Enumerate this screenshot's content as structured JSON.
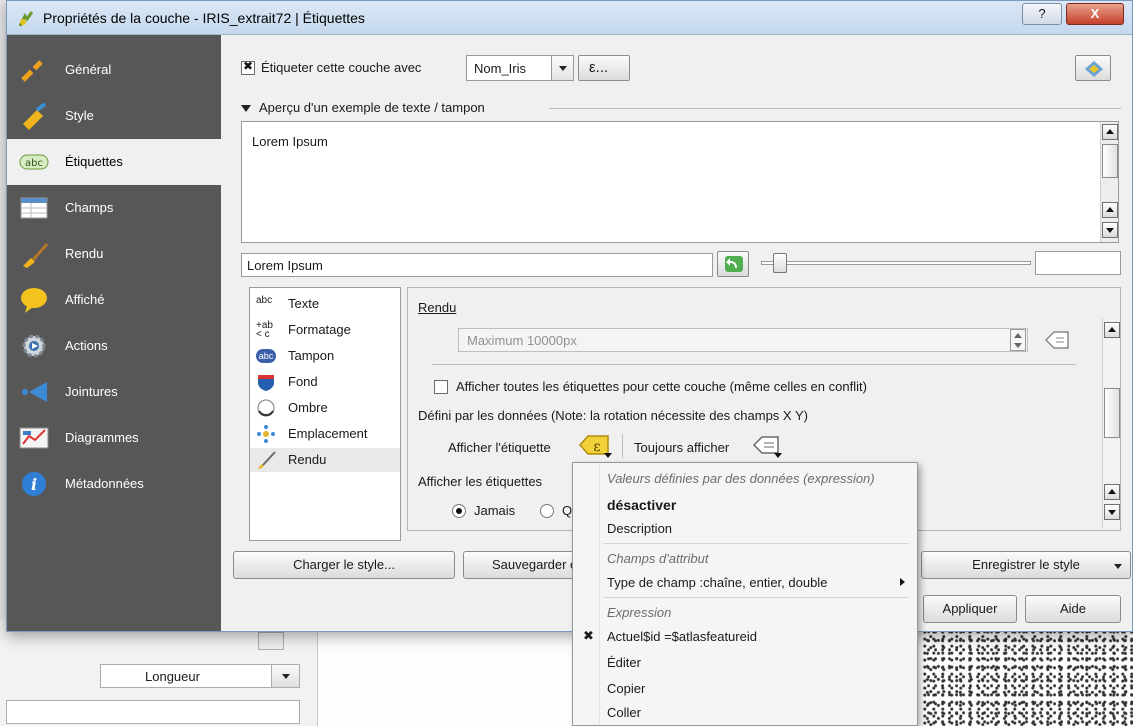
{
  "window": {
    "title": "Propriétés de la couche - IRIS_extrait72 | Étiquettes",
    "help_label": "?",
    "close_label": "X"
  },
  "sidebar": {
    "items": [
      {
        "label": "Général",
        "icon": "general-tools-icon"
      },
      {
        "label": "Style",
        "icon": "style-brush-icon"
      },
      {
        "label": "Étiquettes",
        "icon": "abc-label-icon",
        "active": true
      },
      {
        "label": "Champs",
        "icon": "table-fields-icon"
      },
      {
        "label": "Rendu",
        "icon": "render-brush-icon"
      },
      {
        "label": "Affiché",
        "icon": "speech-bubble-icon"
      },
      {
        "label": "Actions",
        "icon": "actions-gear-icon"
      },
      {
        "label": "Jointures",
        "icon": "join-arrow-icon"
      },
      {
        "label": "Diagrammes",
        "icon": "diagram-icon"
      },
      {
        "label": "Métadonnées",
        "icon": "info-icon"
      }
    ]
  },
  "labeling": {
    "checkbox_label": "Étiqueter cette couche avec",
    "checked": true,
    "field_value": "Nom_Iris",
    "expression_button": "ε...",
    "preview_section": "Aperçu d'un exemple de texte / tampon",
    "preview_text": "Lorem Ipsum",
    "sample_input": "Lorem Ipsum"
  },
  "categories": [
    {
      "label": "Texte",
      "icon": "text-abc-icon"
    },
    {
      "label": "Formatage",
      "icon": "formatting-icon"
    },
    {
      "label": "Tampon",
      "icon": "buffer-abc-icon"
    },
    {
      "label": "Fond",
      "icon": "background-shield-icon"
    },
    {
      "label": "Ombre",
      "icon": "shadow-circle-icon"
    },
    {
      "label": "Emplacement",
      "icon": "placement-icon"
    },
    {
      "label": "Rendu",
      "icon": "rendering-brush-icon",
      "selected": true
    }
  ],
  "rendering": {
    "section_title": "Rendu",
    "max_value": "Maximum 10000px",
    "show_all_label": "Afficher toutes les étiquettes pour cette couche (même celles en conflit)",
    "data_defined_note": "Défini par les données (Note: la rotation nécessite des champs X Y)",
    "show_label": "Afficher l'étiquette",
    "always_show": "Toujours afficher",
    "show_labels_prefix": "Afficher les étiquettes",
    "radio_never": "Jamais",
    "radio_other": "Qu"
  },
  "buttons": {
    "load_style": "Charger le style...",
    "save_style_partial": "Sauvegarder co",
    "save_as_style": "Enregistrer le style",
    "apply": "Appliquer",
    "help": "Aide"
  },
  "context_menu": {
    "header_expression_values": "Valeurs définies par des données (expression)",
    "deactivate": "désactiver",
    "description": "Description",
    "header_attribute_fields": "Champs d'attribut",
    "field_type": "Type de champ :chaîne, entier, double",
    "header_expression": "Expression",
    "current_expression": "Actuel$id =$atlasfeatureid",
    "edit": "Éditer",
    "copy": "Copier",
    "paste": "Coller"
  },
  "background": {
    "combo_value": "Longueur"
  }
}
